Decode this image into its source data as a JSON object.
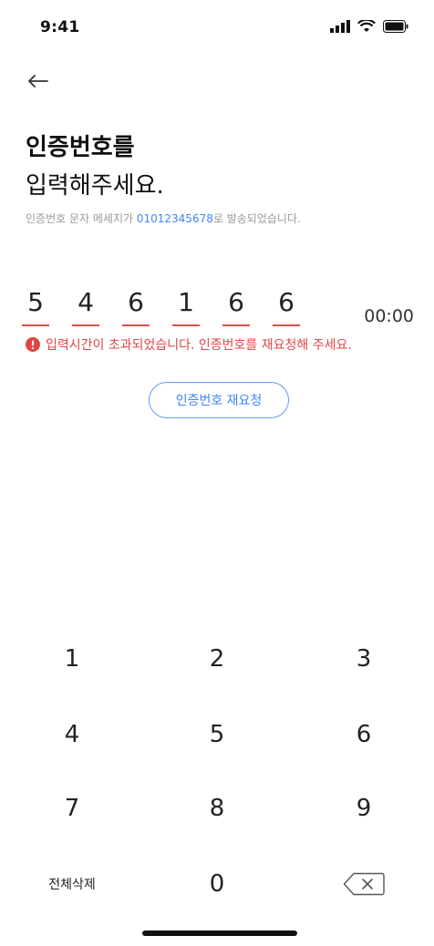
{
  "status": {
    "time": "9:41"
  },
  "header": {
    "title_line1": "인증번호를",
    "title_line2": "입력해주세요."
  },
  "subtitle": {
    "prefix": "인증번호 문자 메세지가 ",
    "phone": "01012345678",
    "suffix": "로 발송되었습니다."
  },
  "code": {
    "digits": [
      "5",
      "4",
      "6",
      "1",
      "6",
      "6"
    ],
    "timer": "00:00"
  },
  "error": {
    "message": "입력시간이 초과되었습니다. 인증번호를 재요청해 주세요."
  },
  "resend": {
    "label": "인증번호 재요청"
  },
  "keypad": {
    "k1": "1",
    "k2": "2",
    "k3": "3",
    "k4": "4",
    "k5": "5",
    "k6": "6",
    "k7": "7",
    "k8": "8",
    "k9": "9",
    "clear_all": "전체삭제",
    "k0": "0"
  },
  "colors": {
    "accent": "#3f86f5",
    "error": "#e04545",
    "underline": "#e74a4a"
  }
}
